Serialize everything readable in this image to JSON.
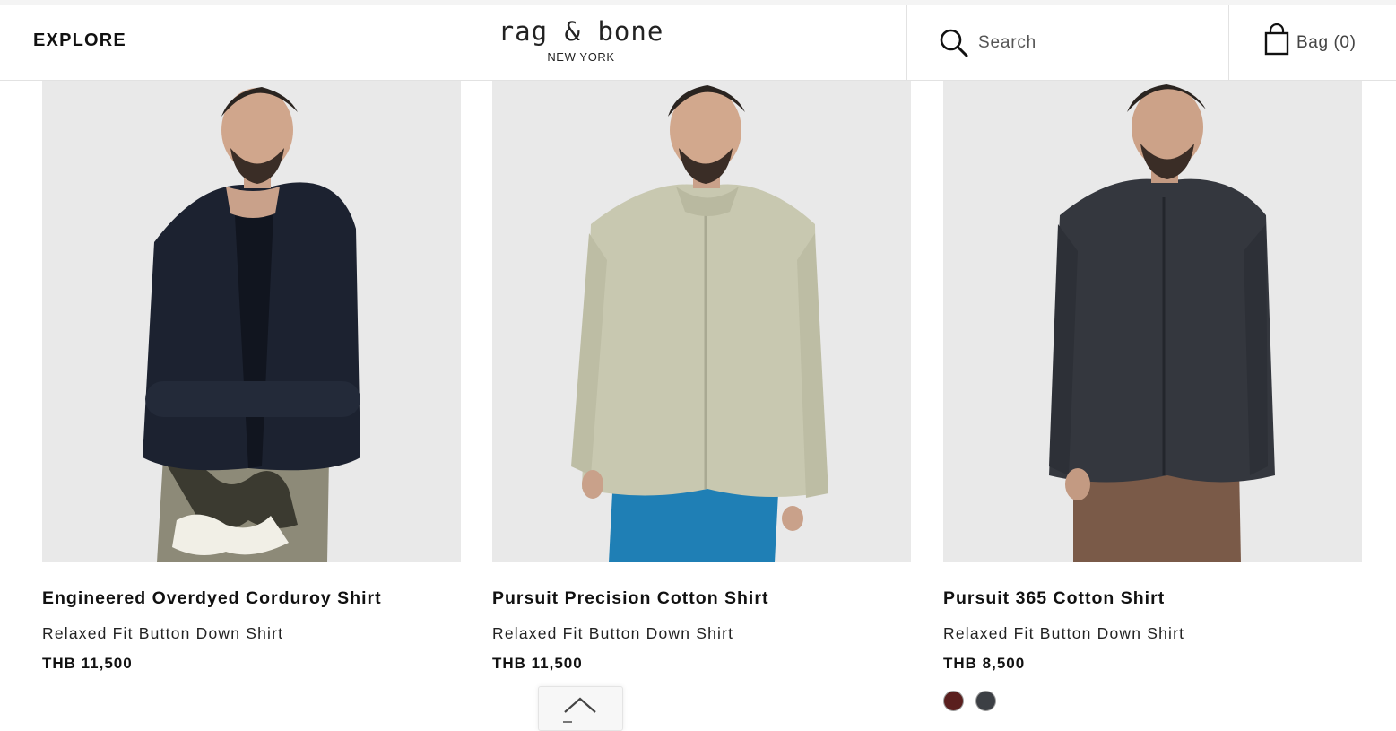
{
  "header": {
    "explore_label": "EXPLORE",
    "logo_main": "rag & bone",
    "logo_sub": "NEW YORK",
    "search_placeholder": "Search",
    "bag_label": "Bag (0)"
  },
  "products": [
    {
      "name": "Engineered Overdyed Corduroy Shirt",
      "subtitle": "Relaxed Fit Button Down Shirt",
      "price": "THB 11,500",
      "image": "model-navy-corduroy-shirt-camo-pants"
    },
    {
      "name": "Pursuit Precision Cotton Shirt",
      "subtitle": "Relaxed Fit Button Down Shirt",
      "price": "THB 11,500",
      "image": "model-sage-shirt-blue-pants"
    },
    {
      "name": "Pursuit 365 Cotton Shirt",
      "subtitle": "Relaxed Fit Button Down Shirt",
      "price": "THB 8,500",
      "image": "model-charcoal-shirt-brown-pants",
      "swatches": [
        "#5a1f1e",
        "#3c3f44"
      ]
    }
  ],
  "back_to_top": {
    "icon": "chevron-up-icon"
  },
  "colors": {
    "text": "#111111",
    "photo_bg": "#e9e9e9",
    "border": "#e2e2e2"
  }
}
